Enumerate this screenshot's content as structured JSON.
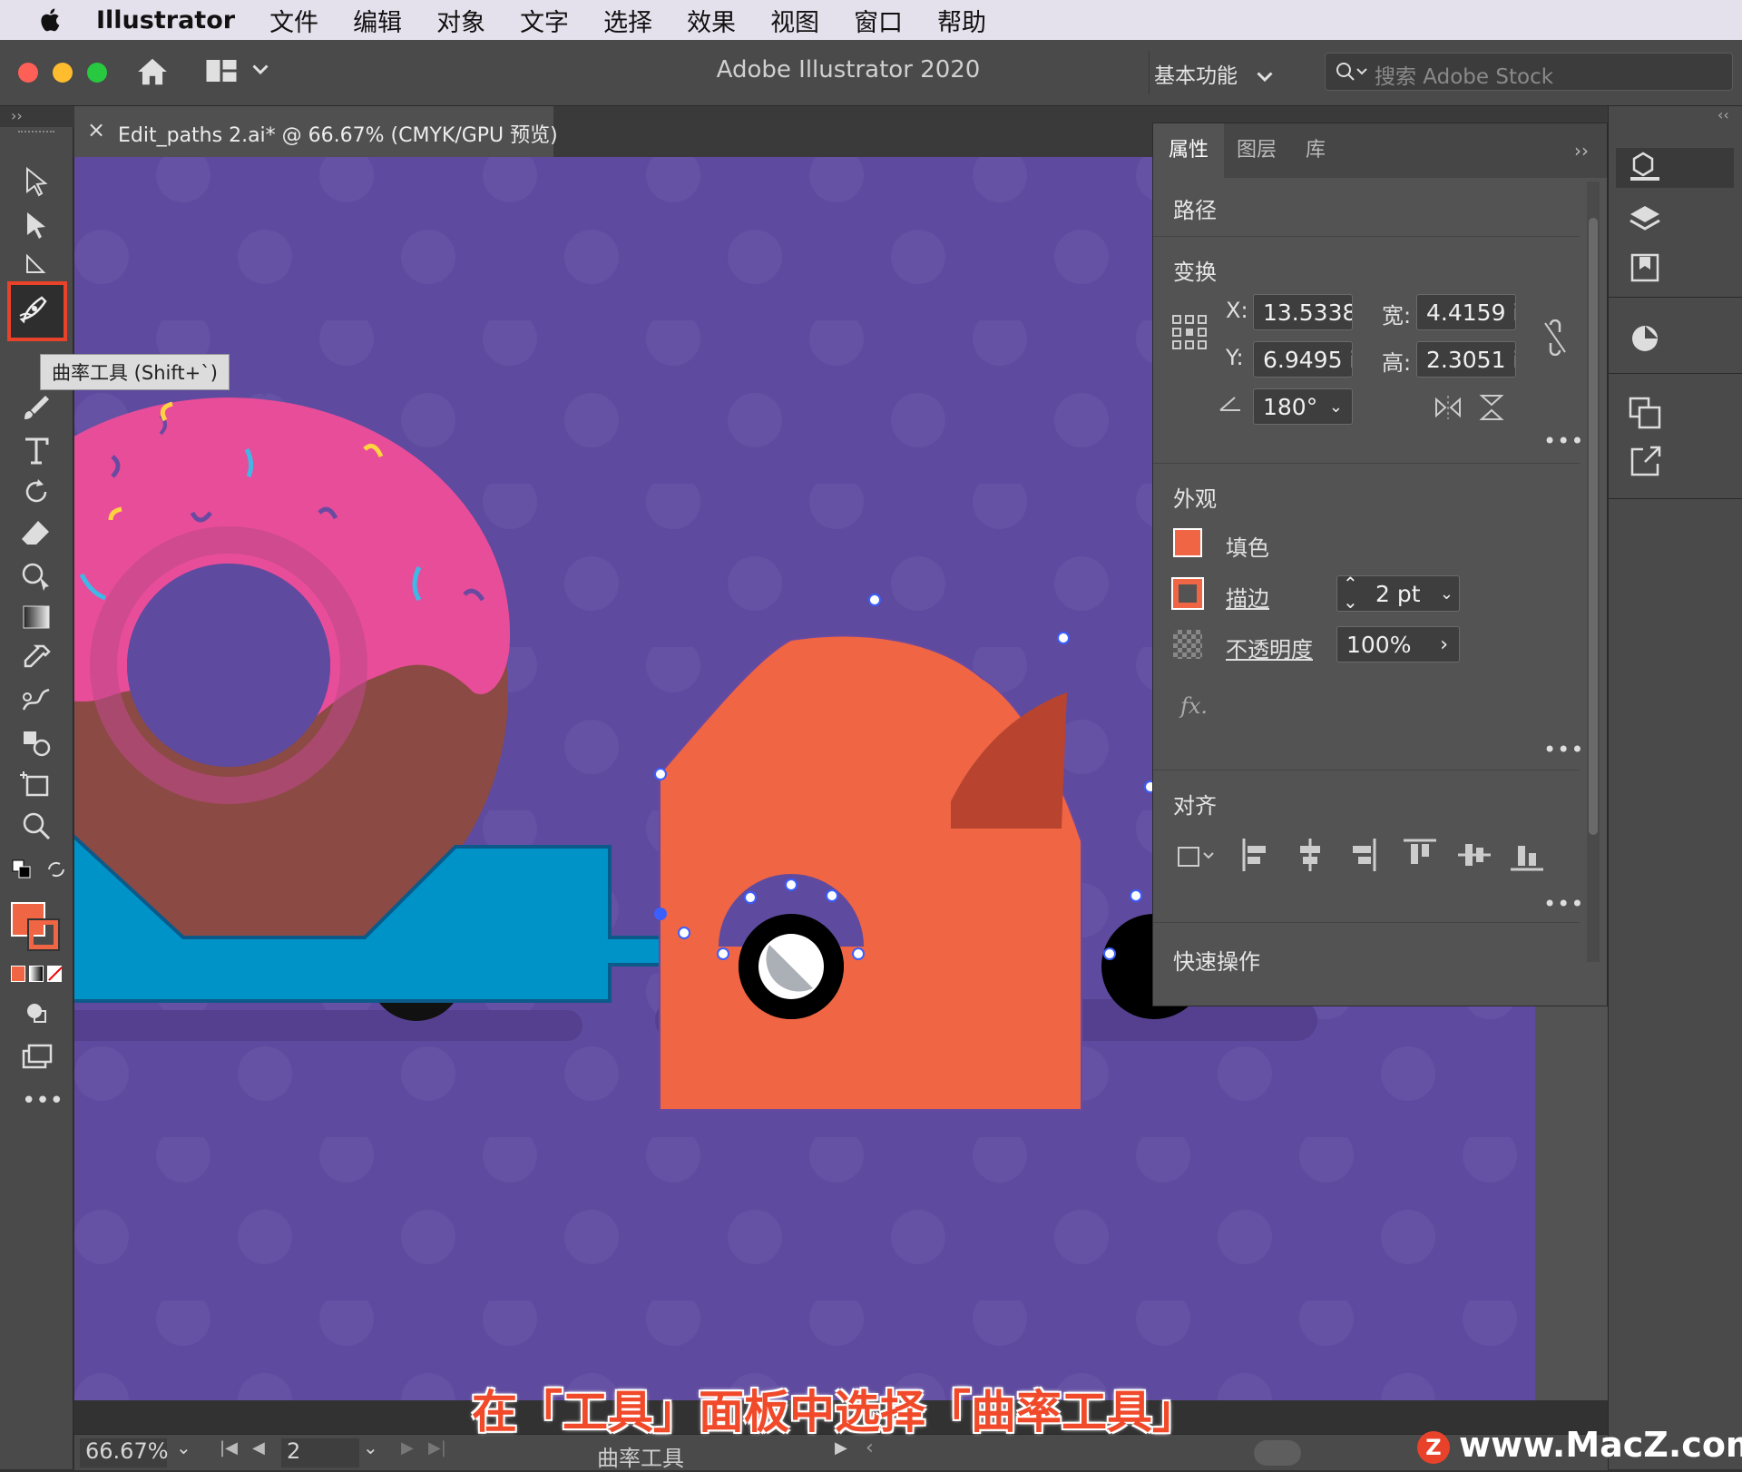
{
  "menubar": {
    "app_name": "Illustrator",
    "items": [
      "文件",
      "编辑",
      "对象",
      "文字",
      "选择",
      "效果",
      "视图",
      "窗口",
      "帮助"
    ]
  },
  "titlebar": {
    "title": "Adobe Illustrator 2020",
    "workspace": "基本功能",
    "search_placeholder": "搜索 Adobe Stock"
  },
  "document_tab": {
    "close": "×",
    "title": "Edit_paths 2.ai* @ 66.67% (CMYK/GPU 预览)"
  },
  "tooltip": "曲率工具 (Shift+`)",
  "panel": {
    "tabs": [
      "属性",
      "图层",
      "库"
    ],
    "selection_type": "路径",
    "transform": {
      "heading": "变换",
      "x_label": "X:",
      "x": "13.5338",
      "y_label": "Y:",
      "y": "6.9495 i",
      "w_label": "宽:",
      "w": "4.4159 ir",
      "h_label": "高:",
      "h": "2.3051 ir",
      "angle": "180°"
    },
    "appearance": {
      "heading": "外观",
      "fill_label": "填色",
      "stroke_label": "描边",
      "stroke_weight": "2 pt",
      "opacity_label": "不透明度",
      "opacity": "100%",
      "fx": "fx."
    },
    "align_heading": "对齐",
    "quick_actions": "快速操作",
    "more": "•••"
  },
  "status": {
    "zoom": "66.67%",
    "artboard": "2",
    "tool_name": "曲率工具"
  },
  "caption": "在「工具」面板中选择「曲率工具」",
  "watermark": "www.MacZ.com",
  "colors": {
    "canvas": "#5e4a9e",
    "donut_pink": "#e84d9a",
    "donut_brown": "#8b4a44",
    "trailer_blue": "#0093c8",
    "car_orange": "#f06543",
    "car_window": "#b84430",
    "fill_swatch": "#f06543",
    "highlight": "#e8432a"
  },
  "icons": [
    "apple-icon",
    "home-icon",
    "layout-icon",
    "search-icon",
    "selection-icon",
    "direct-selection-icon",
    "pen-icon",
    "curvature-icon",
    "brush-icon",
    "type-icon",
    "rotate-icon",
    "eraser-icon",
    "shape-builder-icon",
    "gradient-icon",
    "eyedropper-icon",
    "blend-icon",
    "symbol-sprayer-icon",
    "artboard-icon",
    "zoom-icon",
    "properties-icon",
    "layers-icon",
    "libraries-icon",
    "color-guide-icon",
    "transform-icon",
    "export-icon"
  ]
}
